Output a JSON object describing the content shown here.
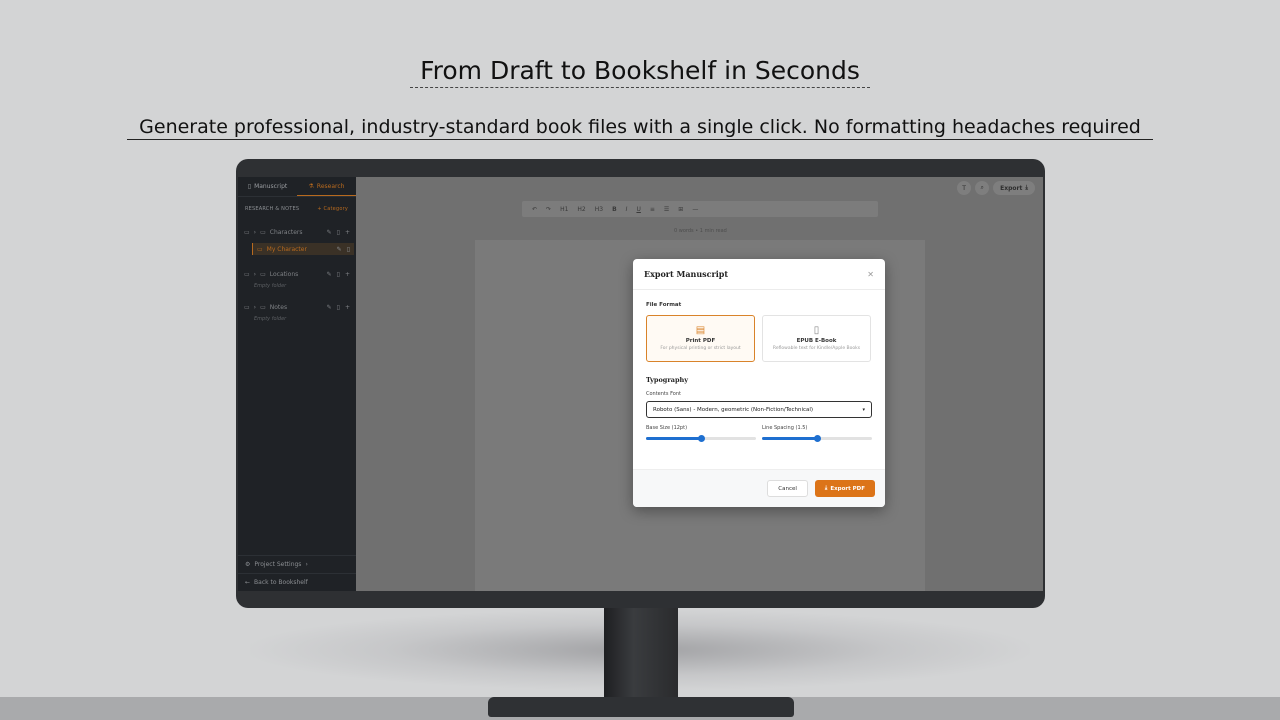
{
  "hero": {
    "headline": "From Draft to Bookshelf in Seconds",
    "subheadline": "Generate professional, industry-standard book files with a single click. No formatting headaches required"
  },
  "sidebar": {
    "tabs": [
      {
        "label": "Manuscript",
        "icon": "book-icon"
      },
      {
        "label": "Research",
        "icon": "flask-icon"
      }
    ],
    "section_title": "RESEARCH & NOTES",
    "add_category": "+ Category",
    "folders": [
      {
        "name": "Characters",
        "children": [
          "My Character"
        ]
      },
      {
        "name": "Locations",
        "empty_text": "Empty folder"
      },
      {
        "name": "Notes",
        "empty_text": "Empty folder"
      }
    ],
    "footer": {
      "project_settings": "Project Settings",
      "back": "Back to Bookshelf"
    }
  },
  "editor": {
    "toolbar": [
      "↶",
      "↷",
      "H1",
      "H2",
      "H3",
      "B",
      "I",
      "U",
      "≡",
      "☰",
      "⊞",
      "—"
    ],
    "word_count": "0 words • 1 min read",
    "top_actions": {
      "font_icon": "T",
      "search_icon": "search-icon",
      "export_label": "Export"
    }
  },
  "modal": {
    "title": "Export Manuscript",
    "file_format_label": "File Format",
    "formats": [
      {
        "name": "Print PDF",
        "desc": "For physical printing or strict layout",
        "selected": true
      },
      {
        "name": "EPUB E-Book",
        "desc": "Reflowable text for Kindle/Apple Books",
        "selected": false
      }
    ],
    "typography_label": "Typography",
    "contents_font_label": "Contents Font",
    "contents_font_value": "Roboto (Sans) - Modern, geometric (Non-Fiction/Technical)",
    "base_size_label": "Base Size (12pt)",
    "base_size_fraction": 0.5,
    "line_spacing_label": "Line Spacing (1.5)",
    "line_spacing_fraction": 0.5,
    "cancel_label": "Cancel",
    "export_label": "Export PDF"
  },
  "colors": {
    "accent": "#dc7418",
    "slider": "#1e6fd0",
    "sidebar_bg": "#1f2226"
  }
}
